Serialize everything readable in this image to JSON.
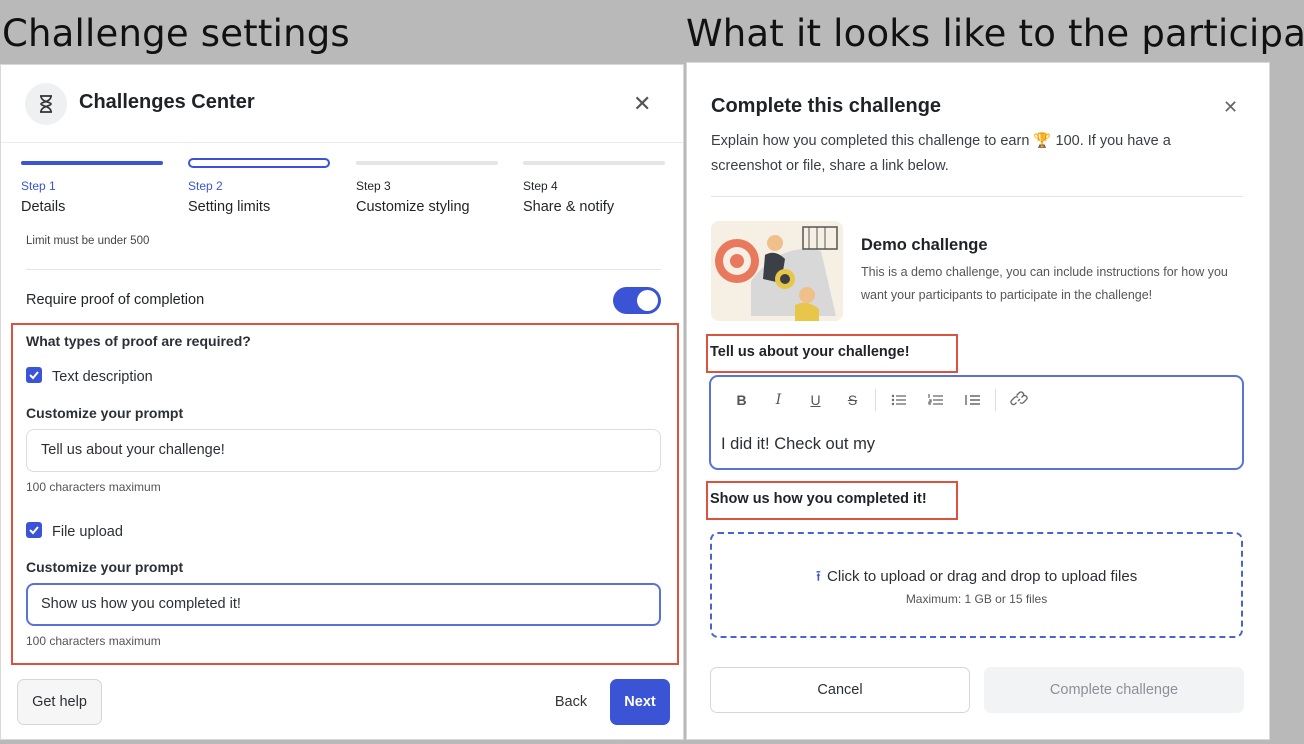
{
  "captions": {
    "left": "Challenge settings",
    "right": "What it looks like to the participant"
  },
  "settings": {
    "title": "Challenges Center",
    "steps": [
      {
        "num": "Step 1",
        "label": "Details"
      },
      {
        "num": "Step 2",
        "label": "Setting limits"
      },
      {
        "num": "Step 3",
        "label": "Customize styling"
      },
      {
        "num": "Step 4",
        "label": "Share & notify"
      }
    ],
    "limit_note": "Limit must be under 500",
    "require_proof_label": "Require proof of completion",
    "require_proof_on": true,
    "proof_types_question": "What types of proof are required?",
    "text_description_label": "Text description",
    "customize_prompt_label": "Customize your prompt",
    "text_prompt_value": "Tell us about your challenge!",
    "char_limit_note": "100 characters maximum",
    "file_upload_label": "File upload",
    "file_prompt_value": "Show us how you completed it!",
    "buttons": {
      "help": "Get help",
      "back": "Back",
      "next": "Next"
    }
  },
  "participant": {
    "title": "Complete this challenge",
    "description": "Explain how you completed this challenge to earn 🏆 100. If you have a screenshot or file, share a link below.",
    "demo_title": "Demo challenge",
    "demo_desc": "This is a demo challenge, you can include instructions for how you want your participants to participate in the challenge!",
    "text_prompt": "Tell us about your challenge!",
    "editor_text": "I did it! Check out my",
    "toolbar": {
      "bold": "B",
      "italic": "I",
      "underline": "U",
      "strike": "S"
    },
    "file_prompt": "Show us how you completed it!",
    "upload_main": "Click to upload or drag and drop to upload files",
    "upload_sub": "Maximum: 1 GB or 15 files",
    "buttons": {
      "cancel": "Cancel",
      "complete": "Complete challenge"
    }
  },
  "colors": {
    "accent": "#3b54d6",
    "highlight_box": "#d9533f"
  }
}
